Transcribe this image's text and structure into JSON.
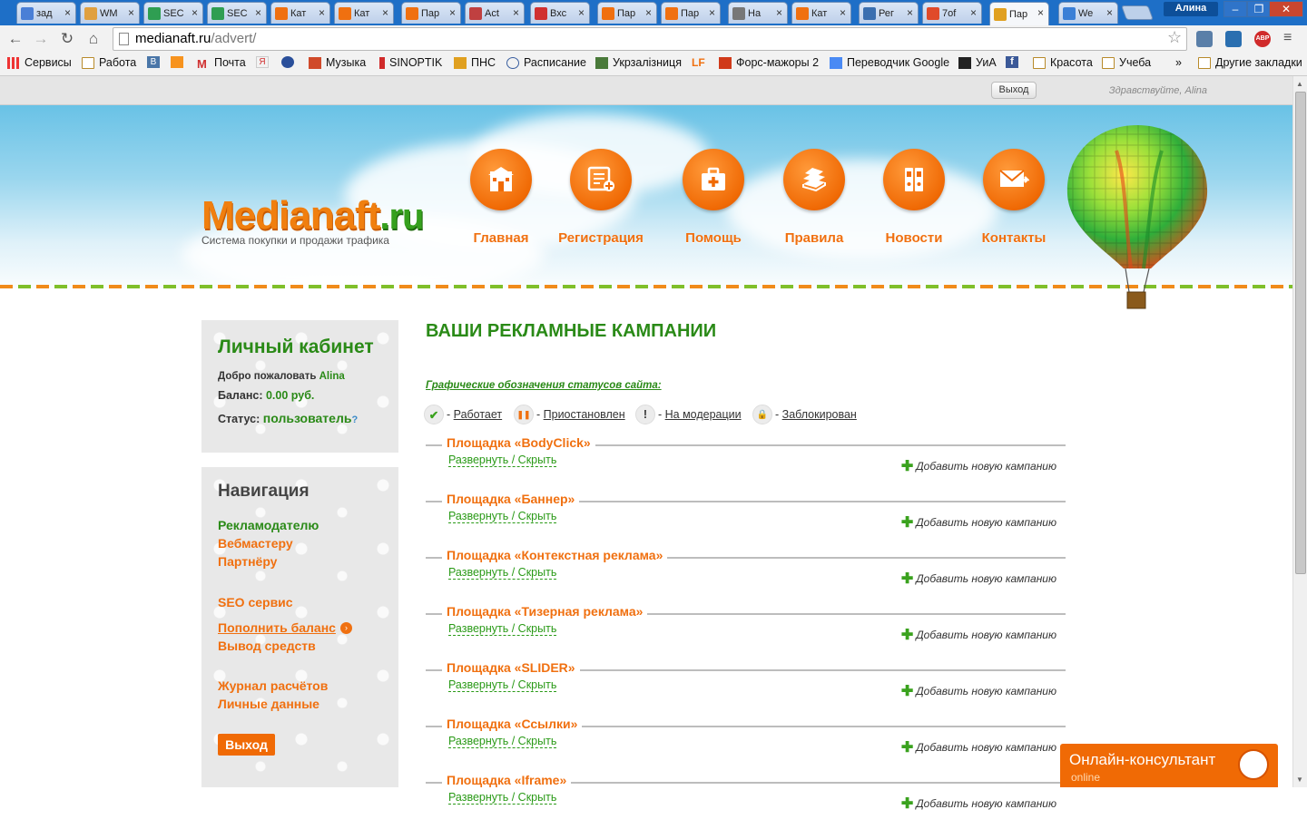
{
  "browser": {
    "tabs": [
      {
        "label": "зад",
        "color": "#4a7fd6"
      },
      {
        "label": "WM",
        "color": "#e0a040"
      },
      {
        "label": "SEC",
        "color": "#2f9e52"
      },
      {
        "label": "SEC",
        "color": "#2f9e52"
      },
      {
        "label": "Кат",
        "color": "#f07010"
      },
      {
        "label": "Кат",
        "color": "#f07010"
      },
      {
        "label": "Пар",
        "color": "#f07010"
      },
      {
        "label": "Act",
        "color": "#c04040"
      },
      {
        "label": "Вхс",
        "color": "#d03030"
      },
      {
        "label": "Пар",
        "color": "#f07010"
      },
      {
        "label": "Пар",
        "color": "#f07010"
      },
      {
        "label": "На",
        "color": "#777777"
      },
      {
        "label": "Кат",
        "color": "#f07010"
      },
      {
        "label": "Рег",
        "color": "#3a6fb0"
      },
      {
        "label": "7of",
        "color": "#e04a2a"
      },
      {
        "label": "Пар",
        "color": "#e0a020"
      },
      {
        "label": "We",
        "color": "#3a7fd6"
      }
    ],
    "user": "Алина",
    "url_host": "medianaft.ru",
    "url_path": "/advert/",
    "bookmarks": [
      {
        "label": "Сервисы"
      },
      {
        "label": "Работа"
      },
      {
        "label": ""
      },
      {
        "label": ""
      },
      {
        "label": "Почта"
      },
      {
        "label": ""
      },
      {
        "label": ""
      },
      {
        "label": "Музыка"
      },
      {
        "label": "SINOPTIK"
      },
      {
        "label": "ПНС"
      },
      {
        "label": "Расписание"
      },
      {
        "label": "Укрзалізниця"
      },
      {
        "label": ""
      },
      {
        "label": "Форс-мажоры 2"
      },
      {
        "label": "Переводчик Google"
      },
      {
        "label": "УиА"
      },
      {
        "label": ""
      },
      {
        "label": "Красота"
      },
      {
        "label": "Учеба"
      },
      {
        "label": "»"
      },
      {
        "label": "Другие закладки"
      }
    ],
    "bm_text": {
      "v": "В",
      "ok": "",
      "ya": "Я",
      "lf": "LF",
      "fb": "f",
      "gmail": "M"
    },
    "ext_abp": "ABP"
  },
  "topbar": {
    "greeting": "Здравствуйте, Alina",
    "logout": "Выход"
  },
  "header": {
    "logo_main": "Medianaft",
    "logo_ru": ".ru",
    "tagline": "Система покупки и продажи трафика",
    "menu": [
      {
        "label": "Главная",
        "icon": "home-icon"
      },
      {
        "label": "Регистрация",
        "icon": "register-icon"
      },
      {
        "label": "Помощь",
        "icon": "first-aid-icon"
      },
      {
        "label": "Правила",
        "icon": "books-icon"
      },
      {
        "label": "Новости",
        "icon": "binders-icon"
      },
      {
        "label": "Контакты",
        "icon": "mail-icon"
      }
    ]
  },
  "cabinet": {
    "title": "Личный кабинет",
    "welcome": "Добро пожаловать",
    "username": "Alina",
    "balance_label": "Баланс:",
    "balance_value": "0.00 руб.",
    "status_label": "Статус:",
    "status_value": "пользователь",
    "status_help": "?"
  },
  "navigation": {
    "title": "Навигация",
    "links": [
      {
        "label": "Рекламодателю",
        "active": true
      },
      {
        "label": "Вебмастеру"
      },
      {
        "label": "Партнёру"
      },
      {
        "label": "SEO сервис"
      },
      {
        "label": "Пополнить баланс"
      },
      {
        "label": "Вывод средств"
      },
      {
        "label": "Журнал расчётов"
      },
      {
        "label": "Личные данные"
      }
    ],
    "exit": "Выход"
  },
  "main": {
    "title": "ВАШИ РЕКЛАМНЫЕ КАМПАНИИ",
    "legend_caption": "Графические обозначения статусов сайта:",
    "legend": [
      {
        "label": "Работает",
        "glyph": "✔",
        "color": "#3aa21e"
      },
      {
        "label": "Приостановлен",
        "glyph": "❚❚",
        "color": "#f07010"
      },
      {
        "label": "На модерации",
        "glyph": "!",
        "color": "#222222"
      },
      {
        "label": "Заблокирован",
        "glyph": "🔒",
        "color": "#d03030"
      }
    ],
    "toggle_label": "Развернуть / Скрыть",
    "add_label": "Добавить новую кампанию",
    "platforms": [
      {
        "name": "Площадка «BodyClick»"
      },
      {
        "name": "Площадка «Баннер»"
      },
      {
        "name": "Площадка «Контекстная реклама»"
      },
      {
        "name": "Площадка «Тизерная реклама»"
      },
      {
        "name": "Площадка «SLIDER»"
      },
      {
        "name": "Площадка «Ссылки»"
      },
      {
        "name": "Площадка «Iframe»"
      }
    ]
  },
  "consultant": {
    "title": "Онлайн-консультант",
    "status": "online"
  },
  "colors": {
    "accent_orange": "#f07010",
    "accent_green": "#2a8a17",
    "chrome_blue": "#1e6fc7"
  }
}
